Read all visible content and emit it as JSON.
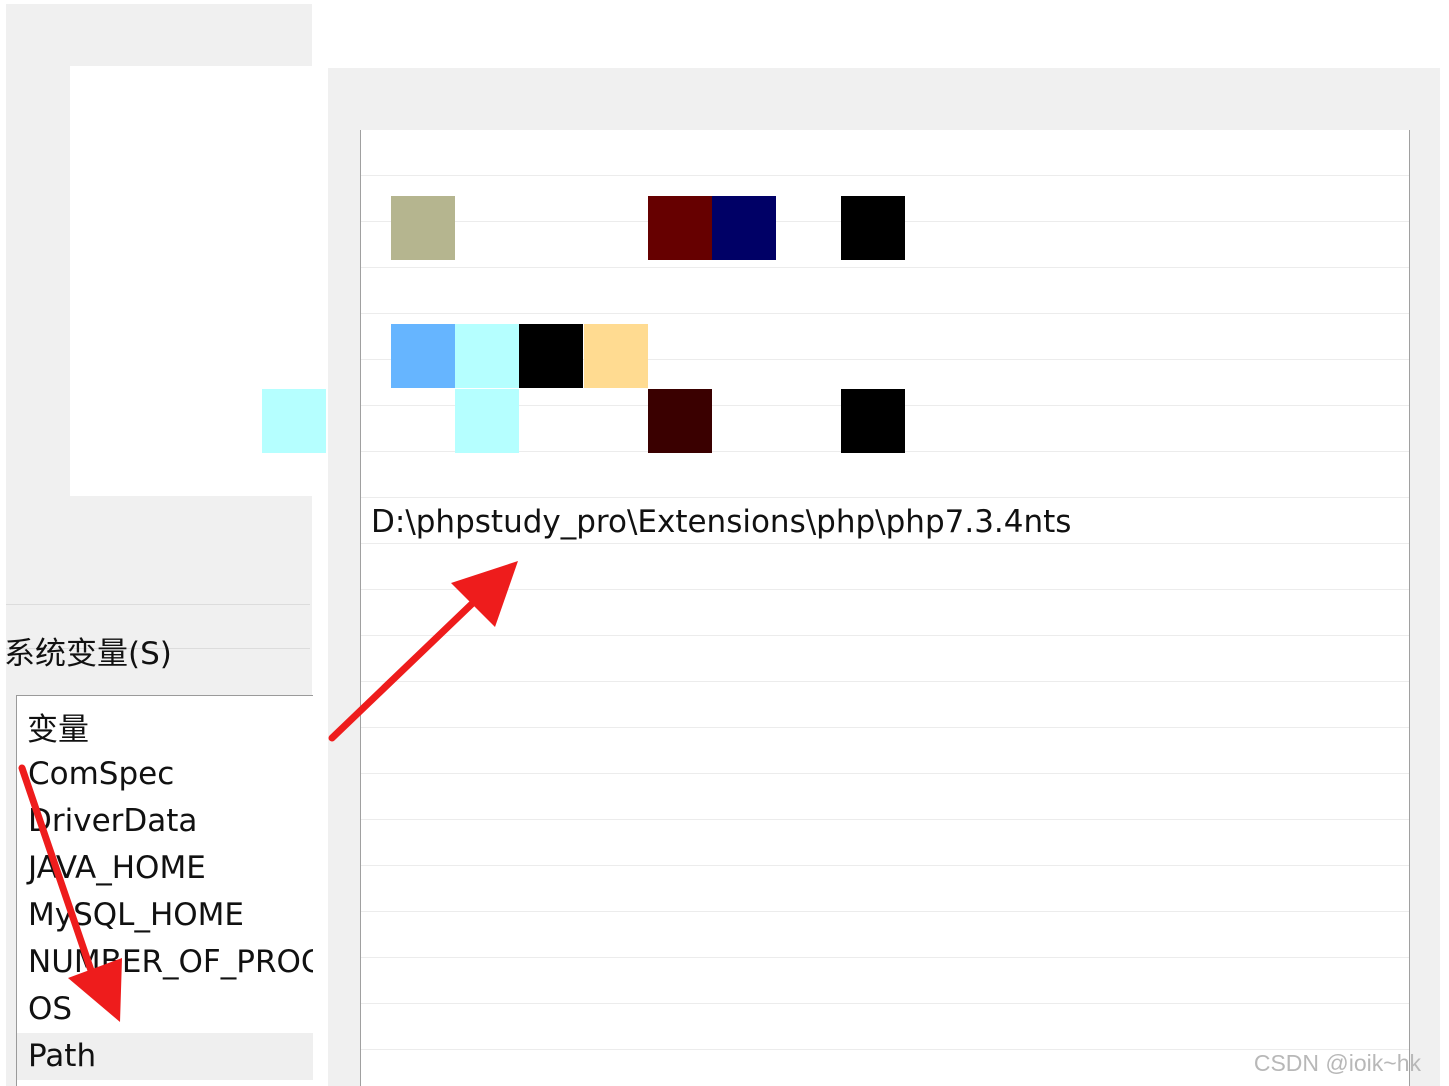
{
  "system_variables": {
    "label": "系统变量(S)",
    "column_header": "变量",
    "rows": [
      {
        "name": "ComSpec"
      },
      {
        "name": "DriverData"
      },
      {
        "name": "JAVA_HOME"
      },
      {
        "name": "MySQL_HOME"
      },
      {
        "name": "NUMBER_OF_PROC"
      },
      {
        "name": "OS"
      },
      {
        "name": "Path",
        "selected": true
      }
    ]
  },
  "edit_variable": {
    "new_entry": "D:\\phpstudy_pro\\Extensions\\php\\php7.3.4nts"
  },
  "mosaic_colors": [
    "#b5b58f",
    "#660000",
    "#000066",
    "#000000",
    "#66b5ff",
    "#b5ffff",
    "#ffdb91",
    "#3a0000"
  ],
  "annotation_color": "#ee1c1c",
  "watermark": "CSDN @ioik~hk"
}
